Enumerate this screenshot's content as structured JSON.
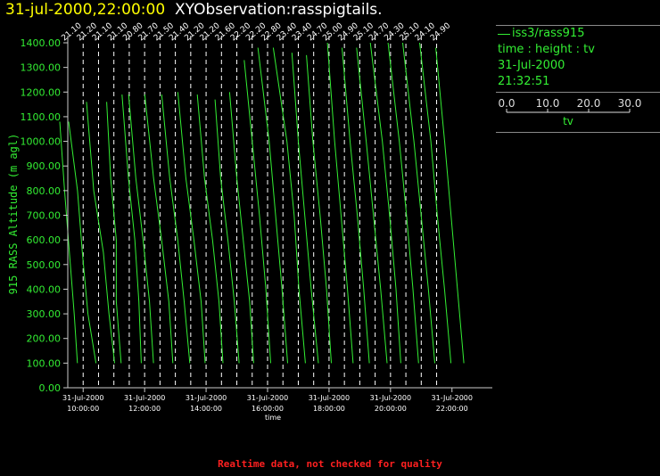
{
  "header": {
    "date_time": "31-jul-2000,22:00:00",
    "product": "XYObservation:rasspigtails."
  },
  "legend": {
    "series": "iss3/rass915",
    "axes": "time : height : tv",
    "date": "31-Jul-2000",
    "time": "21:32:51",
    "scale_ticks": [
      "0.0",
      "10.0",
      "20.0",
      "30.0"
    ],
    "scale_values": [
      0,
      10,
      20,
      30
    ],
    "scale_label": "tv"
  },
  "footer": "Realtime data, not checked for quality",
  "colors": {
    "trace": "#33ee33",
    "axis": "#cccccc",
    "title_date": "#ffff00",
    "footer": "#ff2020"
  },
  "chart_data": {
    "type": "line",
    "ylabel": "915 RASS Altitude (m agl)",
    "xlabel": "time",
    "ylim": [
      0,
      1400
    ],
    "yticks": [
      0,
      100,
      200,
      300,
      400,
      500,
      600,
      700,
      800,
      900,
      1000,
      1100,
      1200,
      1300,
      1400
    ],
    "ytick_labels": [
      "0.00",
      "100.00",
      "200.00",
      "300.00",
      "400.00",
      "500.00",
      "600.00",
      "700.00",
      "800.00",
      "900.00",
      "1000.00",
      "1100.00",
      "1200.00",
      "1300.00",
      "1400.00"
    ],
    "xlim": [
      "31-Jul-2000 09:30",
      "31-Jul-2000 22:30"
    ],
    "xticks": [
      {
        "time": "31-Jul-2000 10:00",
        "date": "31-Jul-2000",
        "clock": "10:00:00"
      },
      {
        "time": "31-Jul-2000 12:00",
        "date": "31-Jul-2000",
        "clock": "12:00:00"
      },
      {
        "time": "31-Jul-2000 14:00",
        "date": "31-Jul-2000",
        "clock": "14:00:00"
      },
      {
        "time": "31-Jul-2000 16:00",
        "date": "31-Jul-2000",
        "clock": "16:00:00"
      },
      {
        "time": "31-Jul-2000 18:00",
        "date": "31-Jul-2000",
        "clock": "18:00:00"
      },
      {
        "time": "31-Jul-2000 20:00",
        "date": "31-Jul-2000",
        "clock": "20:00:00"
      },
      {
        "time": "31-Jul-2000 22:00",
        "date": "31-Jul-2000",
        "clock": "22:00:00"
      }
    ],
    "profiles": [
      {
        "time": "31-Jul-2000 09:30",
        "label": "21.10",
        "points": [
          [
            1.2,
            100
          ],
          [
            0.8,
            300
          ],
          [
            0.2,
            550
          ],
          [
            -0.4,
            800
          ],
          [
            -1.0,
            1080
          ]
        ]
      },
      {
        "time": "31-Jul-2000 10:00",
        "label": "21.20",
        "points": [
          [
            1.6,
            100
          ],
          [
            0.6,
            300
          ],
          [
            -0.1,
            550
          ],
          [
            -0.7,
            800
          ],
          [
            -1.8,
            1080
          ]
        ]
      },
      {
        "time": "31-Jul-2000 10:30",
        "label": "21.10",
        "points": [
          [
            2.0,
            100
          ],
          [
            1.3,
            300
          ],
          [
            0.6,
            550
          ],
          [
            -0.6,
            800
          ],
          [
            -1.5,
            1160
          ]
        ]
      },
      {
        "time": "31-Jul-2000 11:00",
        "label": "21.10",
        "points": [
          [
            0.9,
            100
          ],
          [
            0.3,
            350
          ],
          [
            0.3,
            600
          ],
          [
            -0.4,
            850
          ],
          [
            -0.9,
            1160
          ]
        ]
      },
      {
        "time": "31-Jul-2000 11:30",
        "label": "20.80",
        "points": [
          [
            1.5,
            100
          ],
          [
            1.2,
            350
          ],
          [
            0.7,
            600
          ],
          [
            -0.1,
            850
          ],
          [
            -0.9,
            1190
          ]
        ]
      },
      {
        "time": "31-Jul-2000 12:00",
        "label": "21.70",
        "points": [
          [
            1.1,
            100
          ],
          [
            0.6,
            350
          ],
          [
            -0.2,
            600
          ],
          [
            -1.1,
            850
          ],
          [
            -2.0,
            1190
          ]
        ]
      },
      {
        "time": "31-Jul-2000 12:30",
        "label": "21.50",
        "points": [
          [
            1.6,
            100
          ],
          [
            1.1,
            350
          ],
          [
            0.2,
            600
          ],
          [
            -0.8,
            850
          ],
          [
            -1.9,
            1190
          ]
        ]
      },
      {
        "time": "31-Jul-2000 13:00",
        "label": "21.40",
        "points": [
          [
            1.8,
            100
          ],
          [
            1.1,
            350
          ],
          [
            0.3,
            600
          ],
          [
            -0.7,
            850
          ],
          [
            -1.7,
            1190
          ]
        ]
      },
      {
        "time": "31-Jul-2000 13:30",
        "label": "21.20",
        "points": [
          [
            1.8,
            100
          ],
          [
            1.3,
            350
          ],
          [
            0.4,
            600
          ],
          [
            -0.6,
            850
          ],
          [
            -1.6,
            1200
          ]
        ]
      },
      {
        "time": "31-Jul-2000 14:00",
        "label": "21.20",
        "points": [
          [
            2.1,
            100
          ],
          [
            1.6,
            350
          ],
          [
            0.8,
            600
          ],
          [
            -0.2,
            850
          ],
          [
            -1.1,
            1190
          ]
        ]
      },
      {
        "time": "31-Jul-2000 14:30",
        "label": "21.60",
        "points": [
          [
            2.2,
            100
          ],
          [
            1.6,
            350
          ],
          [
            0.8,
            600
          ],
          [
            -0.1,
            850
          ],
          [
            -0.8,
            1170
          ]
        ]
      },
      {
        "time": "31-Jul-2000 15:00",
        "label": "22.20",
        "points": [
          [
            2.1,
            100
          ],
          [
            1.6,
            350
          ],
          [
            0.8,
            600
          ],
          [
            0.0,
            850
          ],
          [
            -0.9,
            1200
          ]
        ]
      },
      {
        "time": "31-Jul-2000 15:30",
        "label": "22.20",
        "points": [
          [
            2.3,
            100
          ],
          [
            1.7,
            400
          ],
          [
            0.9,
            700
          ],
          [
            0.0,
            1000
          ],
          [
            -1.0,
            1330
          ]
        ]
      },
      {
        "time": "31-Jul-2000 16:00",
        "label": "22.80",
        "points": [
          [
            2.5,
            100
          ],
          [
            1.8,
            400
          ],
          [
            1.0,
            700
          ],
          [
            0.2,
            1000
          ],
          [
            -1.2,
            1380
          ]
        ]
      },
      {
        "time": "31-Jul-2000 16:30",
        "label": "23.40",
        "points": [
          [
            2.8,
            100
          ],
          [
            2.0,
            400
          ],
          [
            1.4,
            700
          ],
          [
            0.5,
            1000
          ],
          [
            -1.2,
            1380
          ]
        ]
      },
      {
        "time": "31-Jul-2000 17:00",
        "label": "23.40",
        "points": [
          [
            2.5,
            100
          ],
          [
            1.6,
            400
          ],
          [
            0.8,
            700
          ],
          [
            0.0,
            1000
          ],
          [
            -0.8,
            1360
          ]
        ]
      },
      {
        "time": "31-Jul-2000 17:30",
        "label": "24.70",
        "points": [
          [
            2.2,
            100
          ],
          [
            1.6,
            400
          ],
          [
            0.8,
            700
          ],
          [
            -0.1,
            1000
          ],
          [
            -0.9,
            1350
          ]
        ]
      },
      {
        "time": "31-Jul-2000 18:00",
        "label": "25.00",
        "points": [
          [
            3.0,
            100
          ],
          [
            2.3,
            400
          ],
          [
            1.5,
            700
          ],
          [
            0.7,
            1000
          ],
          [
            -0.2,
            1400
          ]
        ]
      },
      {
        "time": "31-Jul-2000 18:30",
        "label": "24.90",
        "points": [
          [
            3.1,
            100
          ],
          [
            2.4,
            400
          ],
          [
            1.6,
            700
          ],
          [
            0.7,
            1000
          ],
          [
            -0.3,
            1380
          ]
        ]
      },
      {
        "time": "31-Jul-2000 19:00",
        "label": "25.10",
        "points": [
          [
            3.4,
            100
          ],
          [
            2.6,
            400
          ],
          [
            1.7,
            700
          ],
          [
            0.8,
            1000
          ],
          [
            -0.4,
            1380
          ]
        ]
      },
      {
        "time": "31-Jul-2000 19:30",
        "label": "24.70",
        "points": [
          [
            3.2,
            100
          ],
          [
            2.6,
            400
          ],
          [
            1.8,
            700
          ],
          [
            0.9,
            1000
          ],
          [
            -0.6,
            1400
          ]
        ]
      },
      {
        "time": "31-Jul-2000 20:00",
        "label": "24.30",
        "points": [
          [
            3.5,
            100
          ],
          [
            2.8,
            400
          ],
          [
            2.0,
            700
          ],
          [
            1.1,
            1000
          ],
          [
            -0.3,
            1400
          ]
        ]
      },
      {
        "time": "31-Jul-2000 20:30",
        "label": "25.10",
        "points": [
          [
            3.6,
            100
          ],
          [
            2.8,
            400
          ],
          [
            1.9,
            700
          ],
          [
            1.0,
            1000
          ],
          [
            -0.4,
            1400
          ]
        ]
      },
      {
        "time": "31-Jul-2000 21:00",
        "label": "24.10",
        "points": [
          [
            3.7,
            100
          ],
          [
            2.9,
            400
          ],
          [
            2.0,
            700
          ],
          [
            1.2,
            1000
          ],
          [
            -0.2,
            1400
          ]
        ]
      },
      {
        "time": "31-Jul-2000 21:30",
        "label": "24.90",
        "points": [
          [
            3.4,
            100
          ],
          [
            2.6,
            400
          ],
          [
            1.8,
            700
          ],
          [
            1.0,
            1000
          ],
          [
            -0.1,
            1380
          ]
        ]
      }
    ]
  }
}
